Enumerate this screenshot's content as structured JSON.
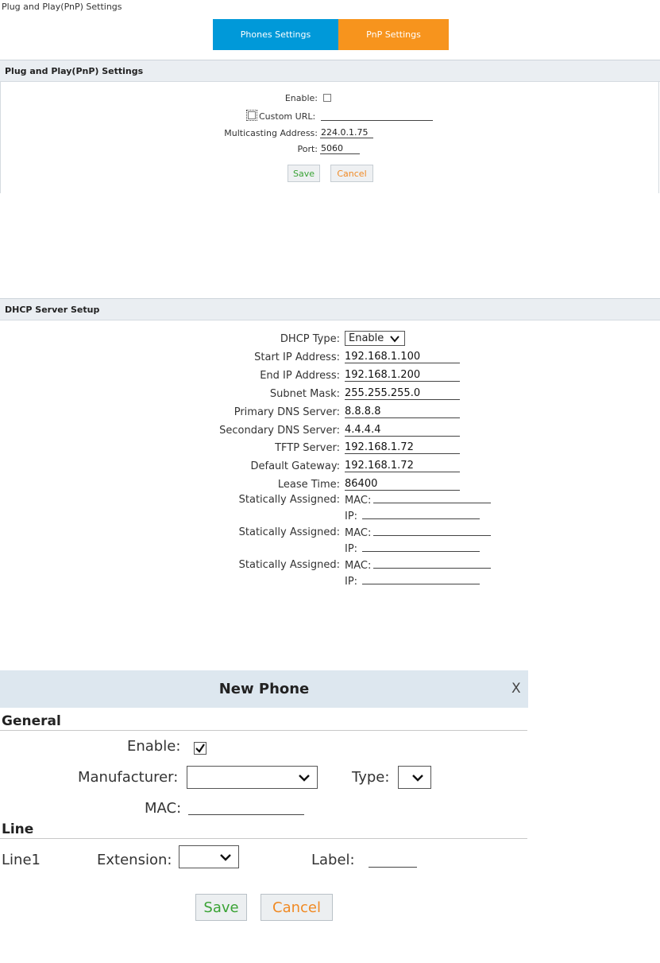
{
  "page_title": "Plug and Play(PnP) Settings",
  "tabs": [
    {
      "label": "Phones Settings",
      "active": false
    },
    {
      "label": "PnP Settings",
      "active": true
    }
  ],
  "pnp": {
    "section_title": "Plug and Play(PnP) Settings",
    "enable_label": "Enable:",
    "enable_checked": false,
    "custom_url_label": "Custom URL:",
    "custom_url_checked": false,
    "custom_url_value": "",
    "multicast_label": "Multicasting Address:",
    "multicast_value": "224.0.1.75",
    "port_label": "Port:",
    "port_value": "5060",
    "save_label": "Save",
    "cancel_label": "Cancel"
  },
  "dhcp": {
    "section_title": "DHCP Server Setup",
    "type_label": "DHCP Type:",
    "type_value": "Enable",
    "start_ip_label": "Start IP Address:",
    "start_ip_value": "192.168.1.100",
    "end_ip_label": "End IP Address:",
    "end_ip_value": "192.168.1.200",
    "subnet_label": "Subnet Mask:",
    "subnet_value": "255.255.255.0",
    "primary_dns_label": "Primary DNS Server:",
    "primary_dns_value": "8.8.8.8",
    "secondary_dns_label": "Secondary DNS Server:",
    "secondary_dns_value": "4.4.4.4",
    "tftp_label": "TFTP Server:",
    "tftp_value": "192.168.1.72",
    "gateway_label": "Default Gateway:",
    "gateway_value": "192.168.1.72",
    "lease_label": "Lease Time:",
    "lease_value": "86400",
    "static_label": "Statically Assigned:",
    "mac_label": "MAC:",
    "ip_label": "IP:"
  },
  "dialog": {
    "title": "New Phone",
    "close_label": "X",
    "general_title": "General",
    "enable_label": "Enable:",
    "enable_checked": true,
    "manufacturer_label": "Manufacturer:",
    "manufacturer_value": "",
    "type_label": "Type:",
    "mac_label": "MAC:",
    "line_title": "Line",
    "line1_label": "Line1",
    "extension_label": "Extension:",
    "label_label": "Label:",
    "save_label": "Save",
    "cancel_label": "Cancel"
  },
  "colors": {
    "tab_phones": "#0099d9",
    "tab_pnp": "#f7941d",
    "save": "#3aa335",
    "cancel": "#f08a24"
  }
}
